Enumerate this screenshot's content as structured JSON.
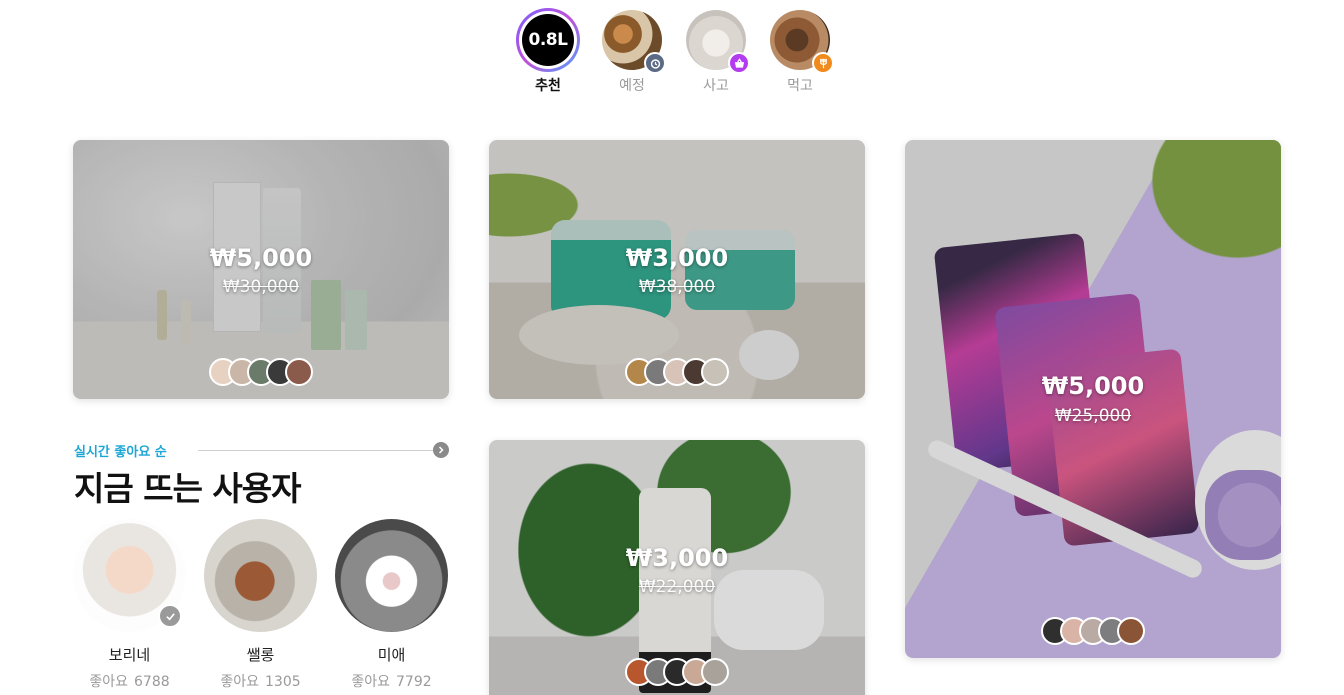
{
  "stories": [
    {
      "label": "추천",
      "brand": "0.8L",
      "active": true
    },
    {
      "label": "예정",
      "badge_icon": "alarm-clock-icon",
      "badge_color": "#5b6b85"
    },
    {
      "label": "사고",
      "badge_icon": "shopping-basket-icon",
      "badge_color": "#b43cf0"
    },
    {
      "label": "먹고",
      "badge_icon": "fork-icon",
      "badge_color": "#f08a1c"
    }
  ],
  "products": [
    {
      "price": "₩5,000",
      "old_price": "₩30,000"
    },
    {
      "price": "₩3,000",
      "old_price": "₩38,000"
    },
    {
      "price": "₩5,000",
      "old_price": "₩25,000"
    },
    {
      "price": "₩3,000",
      "old_price": "₩22,000"
    }
  ],
  "trending": {
    "subtitle": "실시간 좋아요 순",
    "title": "지금 뜨는 사용자",
    "like_label": "좋아요",
    "users": [
      {
        "name": "보리네",
        "likes": "6788",
        "verified": true
      },
      {
        "name": "쌜롱",
        "likes": "1305"
      },
      {
        "name": "미애",
        "likes": "7792"
      }
    ]
  },
  "colors": {
    "accent": "#1ea7d6",
    "price": "#ffffff",
    "muted": "#9a9a9a"
  }
}
